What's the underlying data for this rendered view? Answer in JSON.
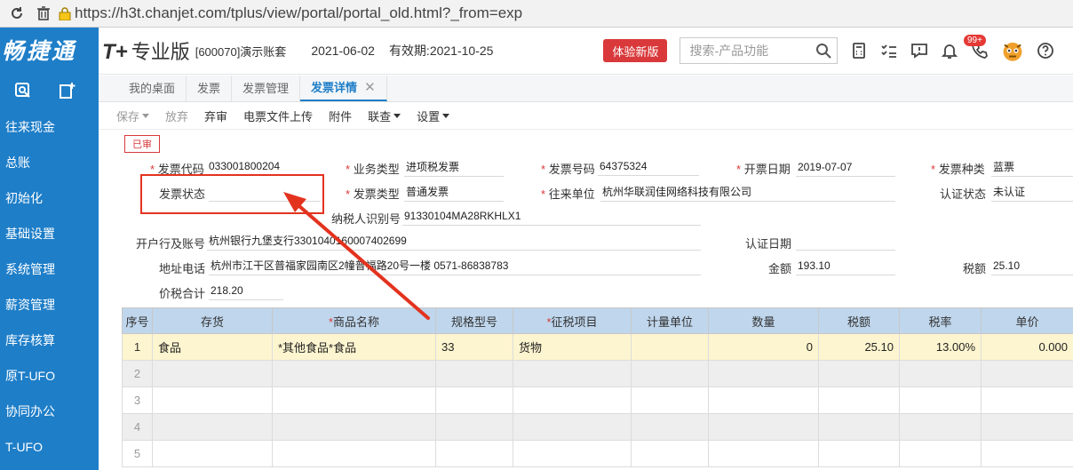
{
  "browser": {
    "url": "https://h3t.chanjet.com/tplus/view/portal/portal_old.html?_from=exp"
  },
  "sidebar": {
    "logo": "畅捷通",
    "items": [
      "往来现金",
      "总账",
      "初始化",
      "基础设置",
      "系统管理",
      "薪资管理",
      "库存核算",
      "原T-UFO",
      "协同办公",
      "T-UFO"
    ]
  },
  "header": {
    "brand_t": "T+",
    "brand_name": "专业版",
    "account": "[600070]演示账套",
    "date": "2021-06-02",
    "validity": "有效期:2021-10-25",
    "new_version_button": "体验新版",
    "search_placeholder": "搜索-产品功能",
    "badge": "99+"
  },
  "tabs": [
    {
      "label": "我的桌面"
    },
    {
      "label": "发票"
    },
    {
      "label": "发票管理"
    },
    {
      "label": "发票详情",
      "active": true
    }
  ],
  "toolbar": {
    "save": "保存",
    "discard": "放弃",
    "unapprove": "弃审",
    "upload": "电票文件上传",
    "attachment": "附件",
    "link": "联查",
    "settings": "设置"
  },
  "form": {
    "status_stamp": "已审",
    "invoice_code_label": "发票代码",
    "invoice_code": "033001800204",
    "business_type_label": "业务类型",
    "business_type": "进项税发票",
    "invoice_no_label": "发票号码",
    "invoice_no": "64375324",
    "invoice_date_label": "开票日期",
    "invoice_date": "2019-07-07",
    "invoice_kind_label": "发票种类",
    "invoice_kind": "蓝票",
    "invoice_status_label": "发票状态",
    "invoice_status": "",
    "invoice_type_label": "发票类型",
    "invoice_type": "普通发票",
    "counterparty_label": "往来单位",
    "counterparty": "杭州华联润佳网络科技有限公司",
    "cert_status_label": "认证状态",
    "cert_status": "未认证",
    "taxpayer_id_label": "纳税人识别号",
    "taxpayer_id": "91330104MA28RKHLX1",
    "bank_label": "开户行及账号",
    "bank": "杭州银行九堡支行3301040160007402699",
    "cert_date_label": "认证日期",
    "cert_date": "",
    "address_label": "地址电话",
    "address": "杭州市江干区普福家园南区2幢普福路20号一楼 0571-86838783",
    "amount_label": "金额",
    "amount": "193.10",
    "tax_label": "税额",
    "tax": "25.10",
    "total_label": "价税合计",
    "total": "218.20"
  },
  "grid": {
    "headers": [
      "序号",
      "存货",
      "商品名称",
      "规格型号",
      "征税项目",
      "计量单位",
      "数量",
      "税额",
      "税率",
      "单价"
    ],
    "required": [
      false,
      false,
      true,
      false,
      true,
      false,
      false,
      false,
      false,
      false
    ],
    "rows": [
      [
        "1",
        "食品",
        "*其他食品*食品",
        "33",
        "货物",
        "",
        "0",
        "25.10",
        "13.00%",
        "0.000"
      ],
      [
        "2",
        "",
        "",
        "",
        "",
        "",
        "",
        "",
        "",
        ""
      ],
      [
        "3",
        "",
        "",
        "",
        "",
        "",
        "",
        "",
        "",
        ""
      ],
      [
        "4",
        "",
        "",
        "",
        "",
        "",
        "",
        "",
        "",
        ""
      ],
      [
        "5",
        "",
        "",
        "",
        "",
        "",
        "",
        "",
        "",
        ""
      ]
    ]
  },
  "colors": {
    "sidebar": "#1e7ec8",
    "accent": "#1e7ec8",
    "annotation": "#e3331f",
    "grid_header": "#bfd6ec",
    "selected_row": "#fdf5cf"
  }
}
